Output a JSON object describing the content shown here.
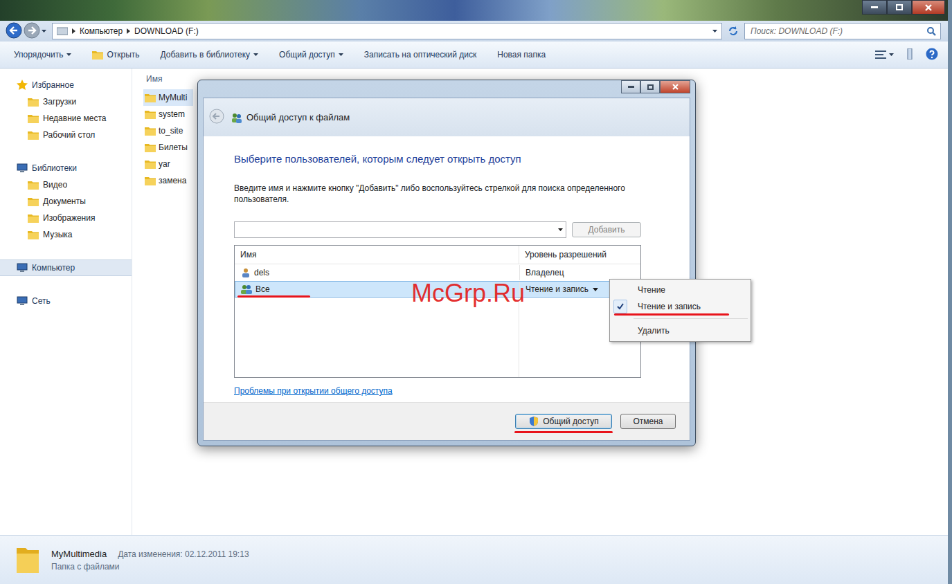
{
  "explorer": {
    "address": {
      "crumbs": [
        "Компьютер",
        "DOWNLOAD (F:)"
      ]
    },
    "search": {
      "placeholder": "Поиск: DOWNLOAD (F:)"
    },
    "toolbar": [
      {
        "label": "Упорядочить",
        "dropdown": true
      },
      {
        "label": "Открыть",
        "dropdown": false
      },
      {
        "label": "Добавить в библиотеку",
        "dropdown": true
      },
      {
        "label": "Общий доступ",
        "dropdown": true
      },
      {
        "label": "Записать на оптический диск",
        "dropdown": false
      },
      {
        "label": "Новая папка",
        "dropdown": false
      }
    ],
    "nav": [
      {
        "label": "Избранное",
        "kind": "group",
        "selected": false
      },
      {
        "label": "Загрузки",
        "kind": "item",
        "selected": false
      },
      {
        "label": "Недавние места",
        "kind": "item",
        "selected": false
      },
      {
        "label": "Рабочий стол",
        "kind": "item",
        "selected": false
      },
      {
        "label": "Библиотеки",
        "kind": "group",
        "selected": false
      },
      {
        "label": "Видео",
        "kind": "item",
        "selected": false
      },
      {
        "label": "Документы",
        "kind": "item",
        "selected": false
      },
      {
        "label": "Изображения",
        "kind": "item",
        "selected": false
      },
      {
        "label": "Музыка",
        "kind": "item",
        "selected": false
      },
      {
        "label": "Компьютер",
        "kind": "group",
        "selected": true
      },
      {
        "label": "Сеть",
        "kind": "group",
        "selected": false
      }
    ],
    "files": {
      "columns": [
        "Имя"
      ],
      "rows": [
        {
          "name": "MyMulti",
          "selected": true
        },
        {
          "name": "system",
          "selected": false
        },
        {
          "name": "to_site",
          "selected": false
        },
        {
          "name": "Билеты",
          "selected": false
        },
        {
          "name": "yar",
          "selected": false
        },
        {
          "name": "замена",
          "selected": false
        }
      ]
    },
    "details": {
      "name": "MyMultimedia",
      "modified": "Дата изменения: 02.12.2011 19:13",
      "type": "Папка с файлами"
    }
  },
  "dialog": {
    "title": "Общий доступ к файлам",
    "heading": "Выберите пользователей, которым следует открыть доступ",
    "instruction": "Введите имя и нажмите кнопку \"Добавить\" либо воспользуйтесь стрелкой для поиска определенного пользователя.",
    "add_button": {
      "label": "Добавить",
      "disabled": true
    },
    "table": {
      "columns": [
        "Имя",
        "Уровень разрешений"
      ],
      "rows": [
        {
          "name": "dels",
          "level": "Владелец",
          "dropdown": false,
          "selected": false,
          "underlined": false
        },
        {
          "name": "Все",
          "level": "Чтение и запись",
          "dropdown": true,
          "selected": true,
          "underlined": true
        }
      ]
    },
    "link": "Проблемы при открытии общего доступа",
    "buttons": [
      {
        "label": "Общий доступ",
        "primary": true,
        "underlined": true
      },
      {
        "label": "Отмена",
        "primary": false,
        "underlined": false
      }
    ]
  },
  "menu": {
    "items": [
      {
        "label": "Чтение",
        "kind": "item",
        "checked": false,
        "underlined": false
      },
      {
        "label": "Чтение и запись",
        "kind": "item",
        "checked": true,
        "underlined": true
      },
      {
        "label": "",
        "kind": "separator",
        "checked": false,
        "underlined": false
      },
      {
        "label": "Удалить",
        "kind": "item",
        "checked": false,
        "underlined": false
      }
    ]
  },
  "watermark": "McGrp.Ru"
}
